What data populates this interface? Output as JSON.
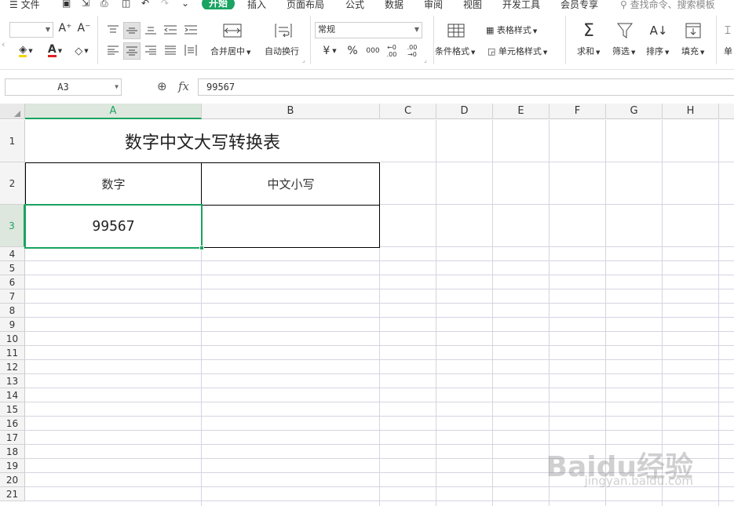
{
  "menu": {
    "file": "文件",
    "tabs": [
      "开始",
      "插入",
      "页面布局",
      "公式",
      "数据",
      "审阅",
      "视图",
      "开发工具",
      "会员专享"
    ],
    "search_placeholder": "查找命令、搜索模板"
  },
  "ribbon": {
    "merge_center": "合并居中",
    "wrap_text": "自动换行",
    "number_format": "常规",
    "cond_format": "条件格式",
    "table_style": "表格样式",
    "cell_style": "单元格样式",
    "sum": "求和",
    "filter": "筛选",
    "sort": "排序",
    "fill": "填充",
    "single": "单"
  },
  "formula_bar": {
    "cell_ref": "A3",
    "fx": "fx",
    "value": "99567"
  },
  "columns": [
    "A",
    "B",
    "C",
    "D",
    "E",
    "F",
    "G",
    "H"
  ],
  "rows": [
    "1",
    "2",
    "3",
    "4",
    "5",
    "6",
    "7",
    "8",
    "9",
    "10",
    "11",
    "12",
    "13",
    "14",
    "15",
    "16",
    "17",
    "18",
    "19",
    "20",
    "21"
  ],
  "sheet": {
    "title": "数字中文大写转换表",
    "header_a": "数字",
    "header_b": "中文小写",
    "a3": "99567",
    "b3": ""
  },
  "watermark": {
    "logo": "Baidu经验",
    "url": "jingyan.baidu.com"
  },
  "colors": {
    "accent": "#1aa361",
    "grid": "#d5d5e3"
  }
}
